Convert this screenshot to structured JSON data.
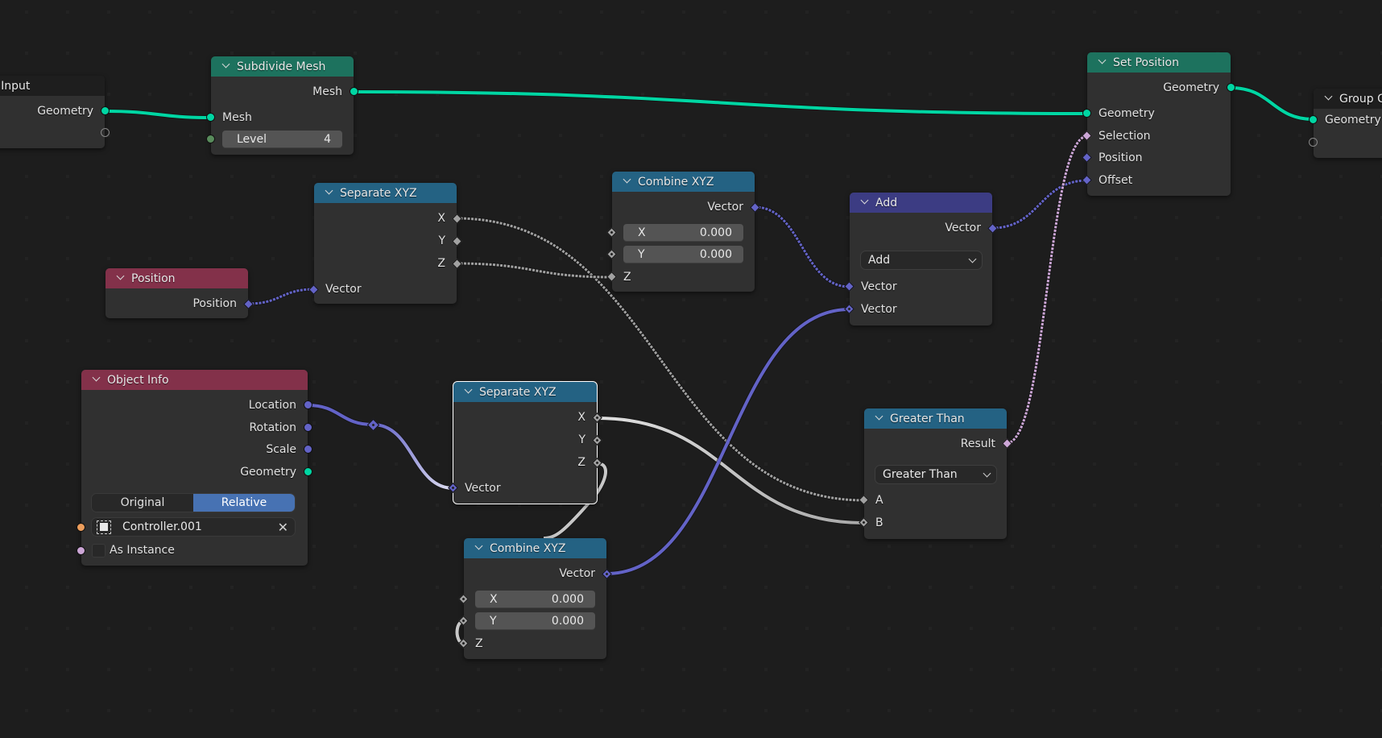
{
  "editor": "Geometry Node Editor",
  "colors": {
    "background": "#1d1d1d",
    "node_body": "#303030",
    "header_geometry": "#1d725e",
    "header_converter": "#246283",
    "header_input": "#83314a",
    "header_vector": "#3c3c83",
    "header_group": "#1e1e1e",
    "socket_geometry": "#00d6a3",
    "socket_vector": "#6363c7",
    "socket_float": "#a1a1a1",
    "socket_bool": "#cca6d6",
    "socket_int": "#598c5c",
    "socket_object": "#ed9e5c",
    "selected_toggle": "#4772b3"
  },
  "nodes": {
    "group_input": {
      "title": "Group Input",
      "outputs": [
        "Geometry"
      ]
    },
    "subdivide_mesh": {
      "title": "Subdivide Mesh",
      "outputs": [
        "Mesh"
      ],
      "inputs": [
        "Mesh"
      ],
      "level_label": "Level",
      "level_value": "4"
    },
    "separate_xyz_1": {
      "title": "Separate XYZ",
      "outputs": [
        "X",
        "Y",
        "Z"
      ],
      "inputs": [
        "Vector"
      ]
    },
    "position": {
      "title": "Position",
      "outputs": [
        "Position"
      ]
    },
    "combine_xyz_1": {
      "title": "Combine XYZ",
      "outputs": [
        "Vector"
      ],
      "x_label": "X",
      "x_value": "0.000",
      "y_label": "Y",
      "y_value": "0.000",
      "z_label": "Z"
    },
    "add": {
      "title": "Add",
      "outputs": [
        "Vector"
      ],
      "operation": "Add",
      "inputs": [
        "Vector",
        "Vector"
      ]
    },
    "set_position": {
      "title": "Set Position",
      "outputs": [
        "Geometry"
      ],
      "inputs": [
        "Geometry",
        "Selection",
        "Position",
        "Offset"
      ]
    },
    "group_output": {
      "title": "Group Output",
      "title_visible": "Group O",
      "inputs": [
        "Geometry"
      ]
    },
    "object_info": {
      "title": "Object Info",
      "outputs": [
        "Location",
        "Rotation",
        "Scale",
        "Geometry"
      ],
      "transform_options": [
        "Original",
        "Relative"
      ],
      "transform_selected": "Relative",
      "object_value": "Controller.001",
      "as_instance_label": "As Instance",
      "as_instance_checked": false
    },
    "separate_xyz_2": {
      "title": "Separate XYZ",
      "outputs": [
        "X",
        "Y",
        "Z"
      ],
      "inputs": [
        "Vector"
      ],
      "selected": true
    },
    "combine_xyz_2": {
      "title": "Combine XYZ",
      "outputs": [
        "Vector"
      ],
      "x_label": "X",
      "x_value": "0.000",
      "y_label": "Y",
      "y_value": "0.000",
      "z_label": "Z"
    },
    "greater_than": {
      "title": "Greater Than",
      "outputs": [
        "Result"
      ],
      "operation": "Greater Than",
      "inputs": [
        "A",
        "B"
      ]
    }
  },
  "links": [
    {
      "from": "Group Input.Geometry",
      "to": "Subdivide Mesh.Mesh",
      "type": "geometry"
    },
    {
      "from": "Subdivide Mesh.Mesh",
      "to": "Set Position.Geometry",
      "type": "geometry"
    },
    {
      "from": "Set Position.Geometry",
      "to": "Group Output.Geometry",
      "type": "geometry"
    },
    {
      "from": "Position.Position",
      "to": "Separate XYZ.Vector",
      "type": "vector-field"
    },
    {
      "from": "Separate XYZ.X",
      "to": "Greater Than.A",
      "type": "float-field"
    },
    {
      "from": "Separate XYZ.Z",
      "to": "Combine XYZ.Z",
      "type": "float-field"
    },
    {
      "from": "Combine XYZ.Vector",
      "to": "Add.Vector",
      "type": "vector-field"
    },
    {
      "from": "Add.Vector",
      "to": "Set Position.Offset",
      "type": "vector-field"
    },
    {
      "from": "Object Info.Location",
      "to": "Reroute",
      "type": "vector"
    },
    {
      "from": "Reroute",
      "to": "Separate XYZ (2).Vector",
      "type": "vector"
    },
    {
      "from": "Separate XYZ (2).X",
      "to": "Greater Than.B",
      "type": "float"
    },
    {
      "from": "Separate XYZ (2).Z",
      "to": "Combine XYZ (2).Z",
      "type": "float"
    },
    {
      "from": "Combine XYZ (2).Vector",
      "to": "Add.Vector (2)",
      "type": "vector"
    },
    {
      "from": "Greater Than.Result",
      "to": "Set Position.Selection",
      "type": "bool-field"
    }
  ]
}
